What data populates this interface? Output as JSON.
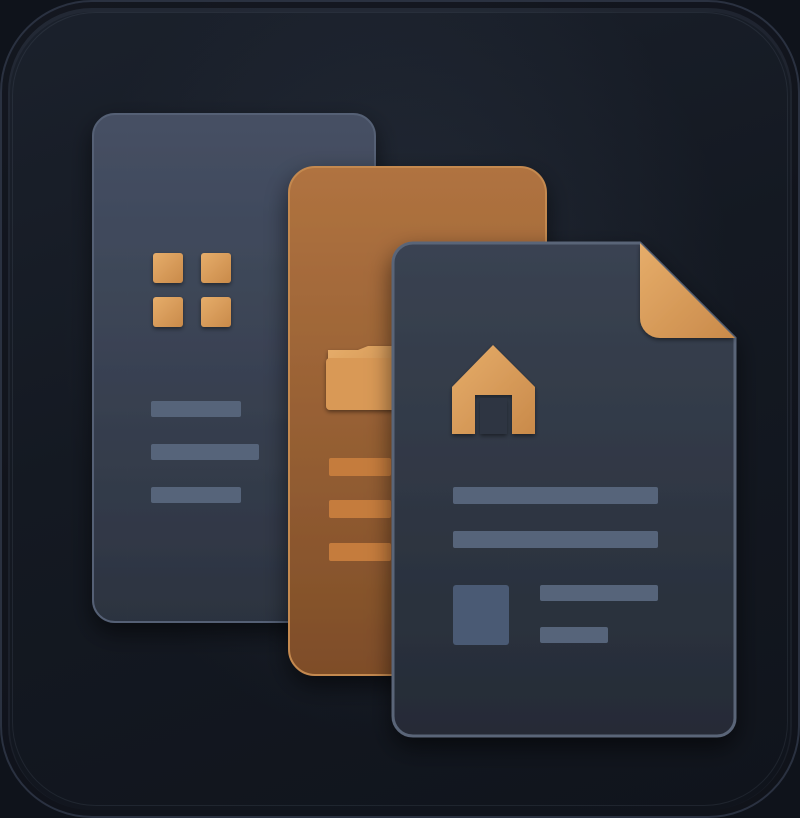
{
  "icon": {
    "name": "documents-app-icon",
    "layers": [
      "grid-panel",
      "folder-panel",
      "document-panel"
    ]
  },
  "colors": {
    "background": "#0f131b",
    "tile": "#161b24",
    "panel_slate": "#3a4353",
    "panel_slate_dark": "#2b3240",
    "panel_copper": "#9a6132",
    "panel_copper_light": "#b87a43",
    "accent_gold": "#d9a05f",
    "line_slate": "#56647a",
    "line_copper": "#c57c3d"
  },
  "glyphs": {
    "grid": "grid-icon",
    "folder": "folder-icon",
    "home": "home-icon",
    "dog_ear": "folded-corner-icon",
    "image": "image-placeholder-icon"
  }
}
